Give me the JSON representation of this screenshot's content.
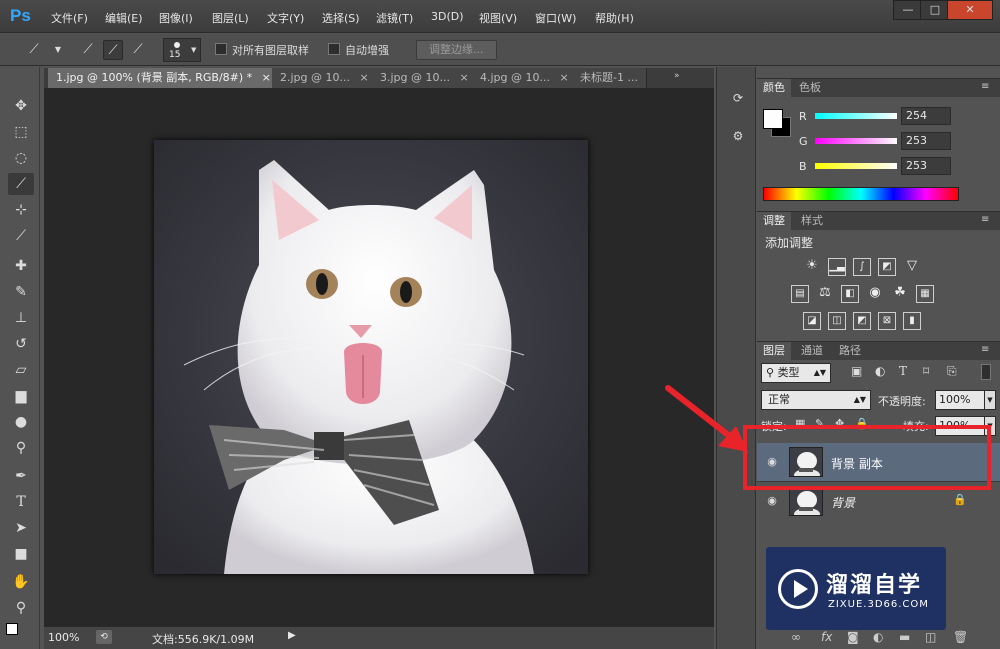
{
  "app": {
    "logo": "Ps"
  },
  "menu": [
    "文件(F)",
    "编辑(E)",
    "图像(I)",
    "图层(L)",
    "文字(Y)",
    "选择(S)",
    "滤镜(T)",
    "3D(D)",
    "视图(V)",
    "窗口(W)",
    "帮助(H)"
  ],
  "window_buttons": {
    "minimize": "—",
    "restore": "□",
    "close": "✕"
  },
  "options_bar": {
    "brush_size": "15",
    "sample_all_layers": "对所有图层取样",
    "auto_enhance": "自动增强",
    "refine_edge": "调整边缘..."
  },
  "document_tabs": [
    {
      "label": "1.jpg @ 100% (背景 副本, RGB/8#) *",
      "close": "×"
    },
    {
      "label": "2.jpg @ 10...",
      "close": "×"
    },
    {
      "label": "3.jpg @ 10...",
      "close": "×"
    },
    {
      "label": "4.jpg @ 10...",
      "close": "×"
    },
    {
      "label": "未标题-1 ...",
      "close": ""
    }
  ],
  "status": {
    "zoom": "100%",
    "doc_info": "文档:556.9K/1.09M"
  },
  "color_panel": {
    "tabs": [
      "颜色",
      "色板"
    ],
    "channels": [
      {
        "name": "R",
        "value": "254",
        "color": "#00e0e0"
      },
      {
        "name": "G",
        "value": "253",
        "color": "#e000e0"
      },
      {
        "name": "B",
        "value": "253",
        "color": "#e0e000"
      }
    ]
  },
  "adjust_panel": {
    "tabs": [
      "调整",
      "样式"
    ],
    "title": "添加调整"
  },
  "layers_panel": {
    "tabs": [
      "图层",
      "通道",
      "路径"
    ],
    "filter_kind": "类型",
    "blend_mode": "正常",
    "opacity_label": "不透明度:",
    "opacity": "100%",
    "lock_label": "锁定:",
    "fill_label": "填充:",
    "fill": "100%",
    "layers": [
      {
        "name": "背景 副本",
        "selected": true
      },
      {
        "name": "背景",
        "selected": false
      }
    ]
  },
  "watermark": {
    "brand": "溜溜自学",
    "url": "ZIXUE.3D66.COM"
  },
  "annotation": {
    "highlight_color": "#e8242a"
  }
}
